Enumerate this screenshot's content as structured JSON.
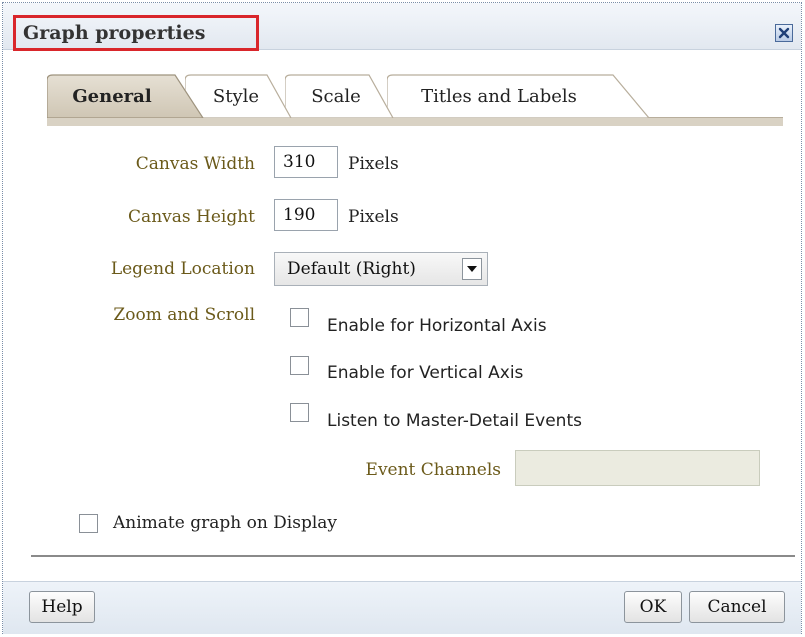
{
  "dialog": {
    "title": "Graph properties",
    "close_icon": "close-icon"
  },
  "tabs": [
    {
      "label": "General",
      "active": true
    },
    {
      "label": "Style",
      "active": false
    },
    {
      "label": "Scale",
      "active": false
    },
    {
      "label": "Titles and Labels",
      "active": false
    }
  ],
  "form": {
    "canvas_width": {
      "label": "Canvas Width",
      "value": "310",
      "unit": "Pixels"
    },
    "canvas_height": {
      "label": "Canvas Height",
      "value": "190",
      "unit": "Pixels"
    },
    "legend_location": {
      "label": "Legend Location",
      "selected": "Default (Right)"
    },
    "zoom_scroll": {
      "label": "Zoom and Scroll",
      "options": [
        {
          "label": "Enable for Horizontal Axis",
          "checked": false
        },
        {
          "label": "Enable for Vertical Axis",
          "checked": false
        },
        {
          "label": "Listen to Master-Detail Events",
          "checked": false
        }
      ]
    },
    "event_channels": {
      "label": "Event Channels",
      "value": ""
    },
    "animate": {
      "label": "Animate graph on Display",
      "checked": false
    }
  },
  "buttons": {
    "help": "Help",
    "ok": "OK",
    "cancel": "Cancel"
  },
  "colors": {
    "highlight_border": "#d9262b",
    "label_text": "#6b5a1a",
    "tab_active": "#d4ccbc"
  }
}
